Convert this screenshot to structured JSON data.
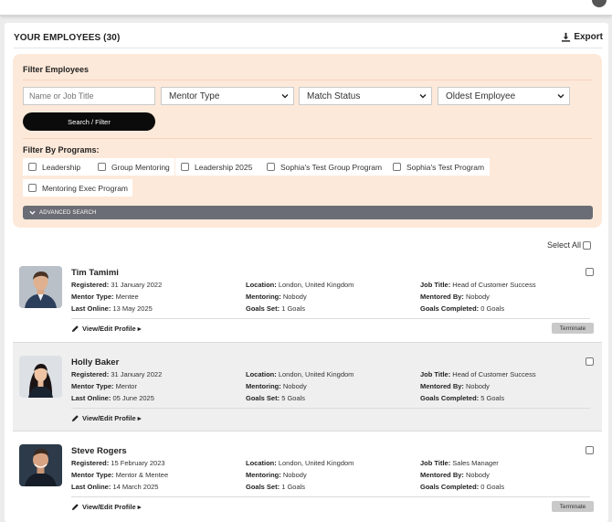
{
  "header": {
    "title": "YOUR EMPLOYEES (30)",
    "export_label": "Export"
  },
  "filters": {
    "title": "Filter Employees",
    "name_placeholder": "Name or Job Title",
    "mentor_type": "Mentor Type",
    "match_status": "Match Status",
    "sort": "Oldest Employee",
    "search_label": "Search / Filter",
    "programs_label": "Filter By Programs:",
    "programs": [
      "Leadership",
      "Group Mentoring",
      "Leadership 2025",
      "Sophia's Test Group Program",
      "Sophia's Test Program",
      "Mentoring Exec Program"
    ],
    "advanced_label": "ADVANCED SEARCH"
  },
  "list": {
    "select_all_label": "Select All"
  },
  "labels": {
    "registered": "Registered:",
    "mentor_type": "Mentor Type:",
    "last_online": "Last Online:",
    "location": "Location:",
    "mentoring": "Mentoring:",
    "goals_set": "Goals Set:",
    "job_title": "Job Title:",
    "mentored_by": "Mentored By:",
    "goals_completed": "Goals Completed:",
    "view_edit": "View/Edit Profile ▸",
    "terminate": "Terminate"
  },
  "employees": [
    {
      "name": "Tim Tamimi",
      "registered": "31 January 2022",
      "mentor_type": "Mentee",
      "last_online": "13 May 2025",
      "location": "London, United Kingdom",
      "mentoring": "Nobody",
      "goals_set": "1 Goals",
      "job_title": "Head of Customer Success",
      "mentored_by": "Nobody",
      "goals_completed": "0 Goals"
    },
    {
      "name": "Holly Baker",
      "registered": "31 January 2022",
      "mentor_type": "Mentor",
      "last_online": "05 June 2025",
      "location": "London, United Kingdom",
      "mentoring": "Nobody",
      "goals_set": "5 Goals",
      "job_title": "Head of Customer Success",
      "mentored_by": "Nobody",
      "goals_completed": "5 Goals"
    },
    {
      "name": "Steve Rogers",
      "registered": "15 February 2023",
      "mentor_type": "Mentor & Mentee",
      "last_online": "14 March 2025",
      "location": "London, United Kingdom",
      "mentoring": "Nobody",
      "goals_set": "1 Goals",
      "job_title": "Sales Manager",
      "mentored_by": "Nobody",
      "goals_completed": "0 Goals"
    }
  ],
  "colors": {
    "filter_bg": "#fde9da",
    "advanced_bar": "#6a6d75",
    "search_button": "#0b0b0b",
    "terminate_button": "#c9c9c9",
    "alt_row": "#efefef"
  }
}
